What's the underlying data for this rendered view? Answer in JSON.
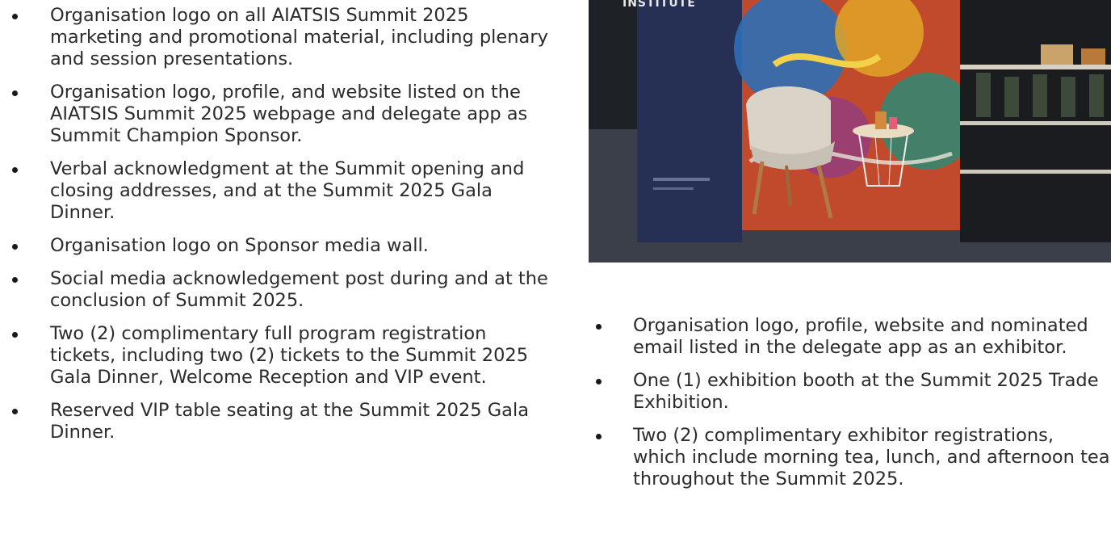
{
  "left_list": {
    "items": [
      {
        "text": "Organisation logo on all AIATSIS Summit 2025 marketing and promotional material, including plenary and session presentations."
      },
      {
        "text": "Organisation logo, profile, and website listed on the AIATSIS Summit 2025 webpage and delegate app as Summit Champion Sponsor."
      },
      {
        "text": "Verbal acknowledgment at the Summit opening and closing addresses, and at the Summit 2025 Gala Dinner."
      },
      {
        "text": "Organisation logo on Sponsor media wall."
      },
      {
        "text": "Social media acknowledgement post during and at the conclusion of Summit 2025."
      },
      {
        "text": "Two (2) complimentary full program registration tickets, including two (2) tickets to the Summit 2025 Gala Dinner, Welcome Reception and VIP event."
      },
      {
        "text": "Reserved VIP table seating at the Summit 2025 Gala Dinner."
      }
    ]
  },
  "photo": {
    "banner_text": "INSTITUTE"
  },
  "right_list": {
    "items": [
      {
        "text": "Organisation logo, profile, website and nominated email listed in the delegate app as an exhibitor."
      },
      {
        "text": "One (1) exhibition booth at the Summit 2025 Trade Exhibition."
      },
      {
        "text": "Two (2) complimentary exhibitor registrations, which include morning tea, lunch, and afternoon tea throughout the Summit 2025."
      }
    ]
  }
}
